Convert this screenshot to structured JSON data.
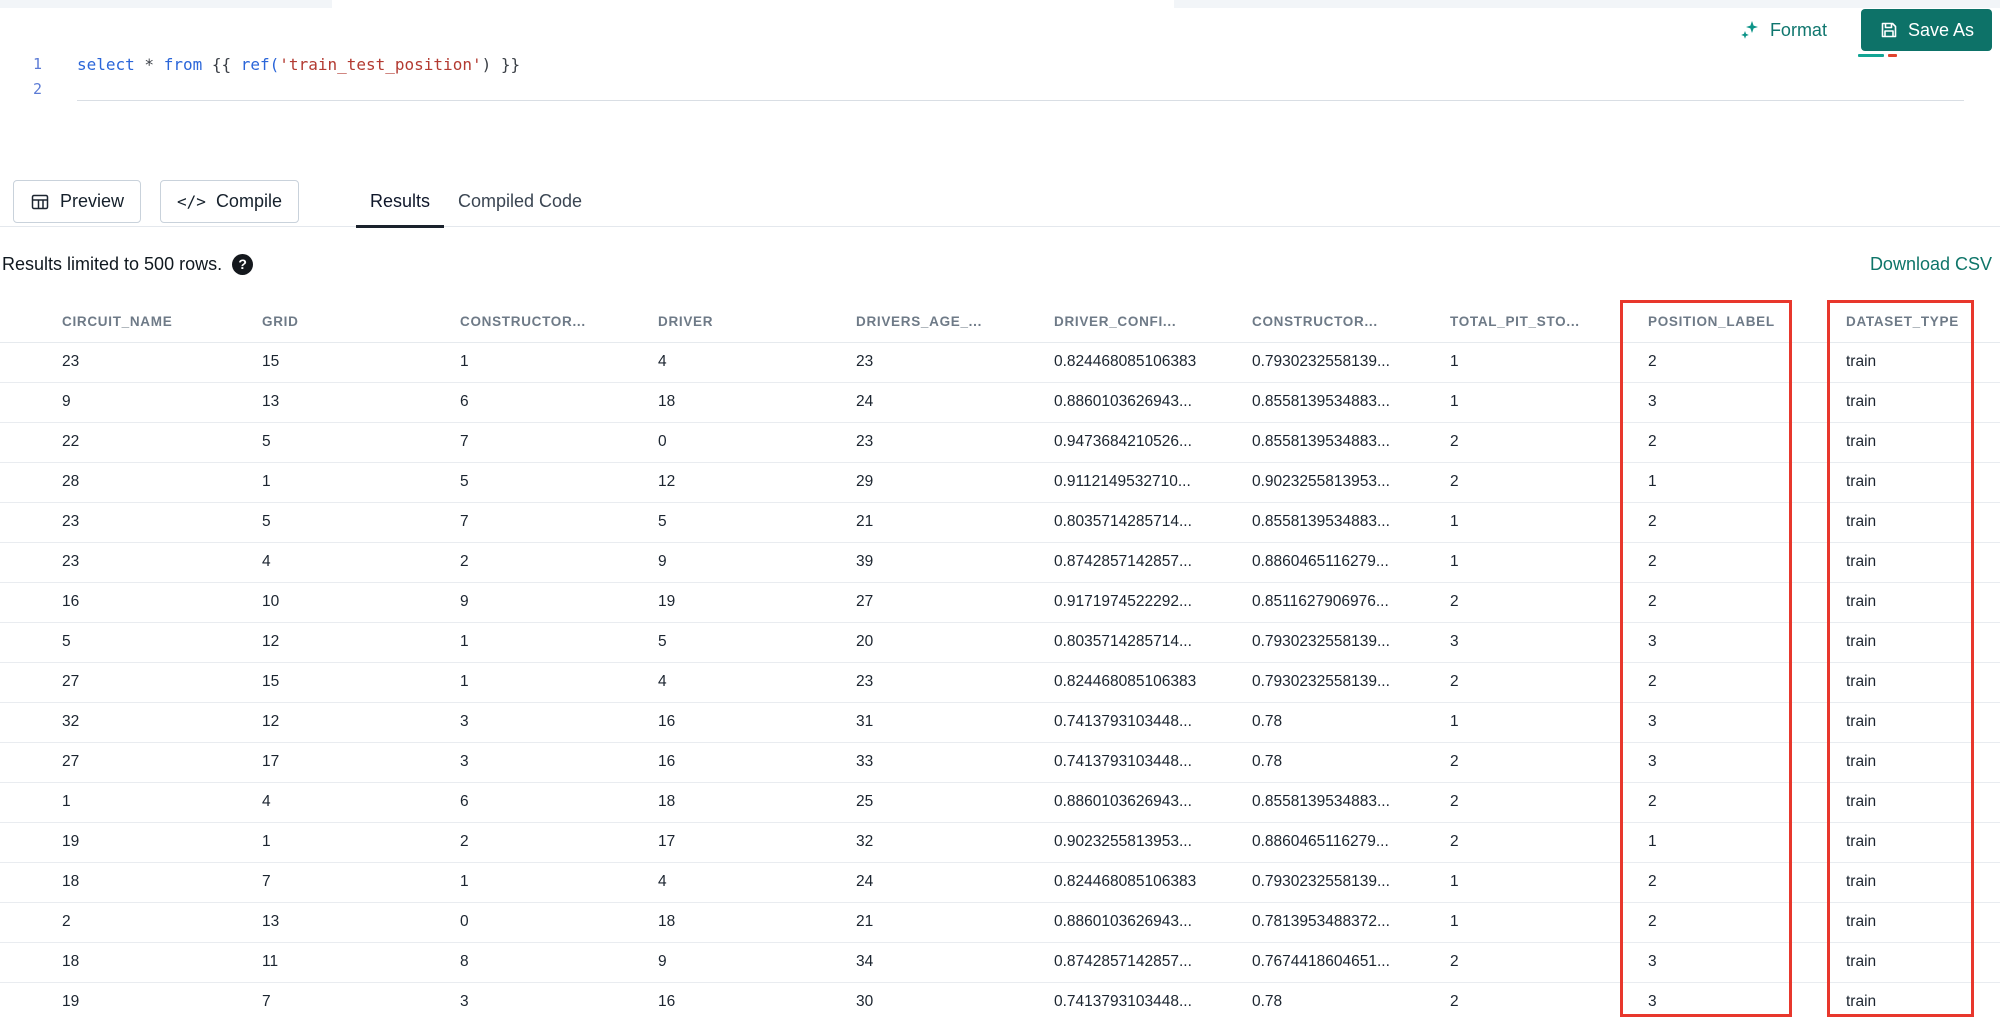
{
  "toolbar": {
    "format_label": "Format",
    "save_as_label": "Save As",
    "preview_label": "Preview",
    "compile_label": "Compile"
  },
  "icons": {
    "compile": "</>"
  },
  "editor": {
    "line_numbers": [
      "1",
      "2"
    ],
    "line1": {
      "kw_select": "select",
      "op_star": " * ",
      "kw_from": "from",
      "jinja_open": " {{ ",
      "fn_ref": "ref(",
      "string": "'train_test_position'",
      "close": ") }}"
    }
  },
  "tabs": [
    {
      "label": "Results",
      "active": true
    },
    {
      "label": "Compiled Code",
      "active": false
    }
  ],
  "results_bar": {
    "limit_text": "Results limited to 500 rows.",
    "help_icon": "?",
    "download_label": "Download CSV"
  },
  "table": {
    "columns": [
      "CIRCUIT_NAME",
      "GRID",
      "CONSTRUCTOR...",
      "DRIVER",
      "DRIVERS_AGE_...",
      "DRIVER_CONFI...",
      "CONSTRUCTOR...",
      "TOTAL_PIT_STO...",
      "POSITION_LABEL",
      "DATASET_TYPE"
    ],
    "rows": [
      [
        "23",
        "15",
        "1",
        "4",
        "23",
        "0.824468085106383",
        "0.7930232558139...",
        "1",
        "2",
        "train"
      ],
      [
        "9",
        "13",
        "6",
        "18",
        "24",
        "0.8860103626943...",
        "0.8558139534883...",
        "1",
        "3",
        "train"
      ],
      [
        "22",
        "5",
        "7",
        "0",
        "23",
        "0.9473684210526...",
        "0.8558139534883...",
        "2",
        "2",
        "train"
      ],
      [
        "28",
        "1",
        "5",
        "12",
        "29",
        "0.9112149532710...",
        "0.9023255813953...",
        "2",
        "1",
        "train"
      ],
      [
        "23",
        "5",
        "7",
        "5",
        "21",
        "0.8035714285714...",
        "0.8558139534883...",
        "1",
        "2",
        "train"
      ],
      [
        "23",
        "4",
        "2",
        "9",
        "39",
        "0.8742857142857...",
        "0.8860465116279...",
        "1",
        "2",
        "train"
      ],
      [
        "16",
        "10",
        "9",
        "19",
        "27",
        "0.9171974522292...",
        "0.8511627906976...",
        "2",
        "2",
        "train"
      ],
      [
        "5",
        "12",
        "1",
        "5",
        "20",
        "0.8035714285714...",
        "0.7930232558139...",
        "3",
        "3",
        "train"
      ],
      [
        "27",
        "15",
        "1",
        "4",
        "23",
        "0.824468085106383",
        "0.7930232558139...",
        "2",
        "2",
        "train"
      ],
      [
        "32",
        "12",
        "3",
        "16",
        "31",
        "0.7413793103448...",
        "0.78",
        "1",
        "3",
        "train"
      ],
      [
        "27",
        "17",
        "3",
        "16",
        "33",
        "0.7413793103448...",
        "0.78",
        "2",
        "3",
        "train"
      ],
      [
        "1",
        "4",
        "6",
        "18",
        "25",
        "0.8860103626943...",
        "0.8558139534883...",
        "2",
        "2",
        "train"
      ],
      [
        "19",
        "1",
        "2",
        "17",
        "32",
        "0.9023255813953...",
        "0.8860465116279...",
        "2",
        "1",
        "train"
      ],
      [
        "18",
        "7",
        "1",
        "4",
        "24",
        "0.824468085106383",
        "0.7930232558139...",
        "1",
        "2",
        "train"
      ],
      [
        "2",
        "13",
        "0",
        "18",
        "21",
        "0.8860103626943...",
        "0.7813953488372...",
        "1",
        "2",
        "train"
      ],
      [
        "18",
        "11",
        "8",
        "9",
        "34",
        "0.8742857142857...",
        "0.7674418604651...",
        "2",
        "3",
        "train"
      ],
      [
        "19",
        "7",
        "3",
        "16",
        "30",
        "0.7413793103448...",
        "0.78",
        "2",
        "3",
        "train"
      ]
    ]
  },
  "annotations": {
    "highlight_color": "#e8372c",
    "highlighted_columns": [
      "POSITION_LABEL",
      "DATASET_TYPE"
    ]
  },
  "colors": {
    "accent_teal": "#0f766e",
    "save_button_bg": "#0d7268",
    "keyword_blue": "#2b66d9",
    "string_red": "#b33a31"
  }
}
